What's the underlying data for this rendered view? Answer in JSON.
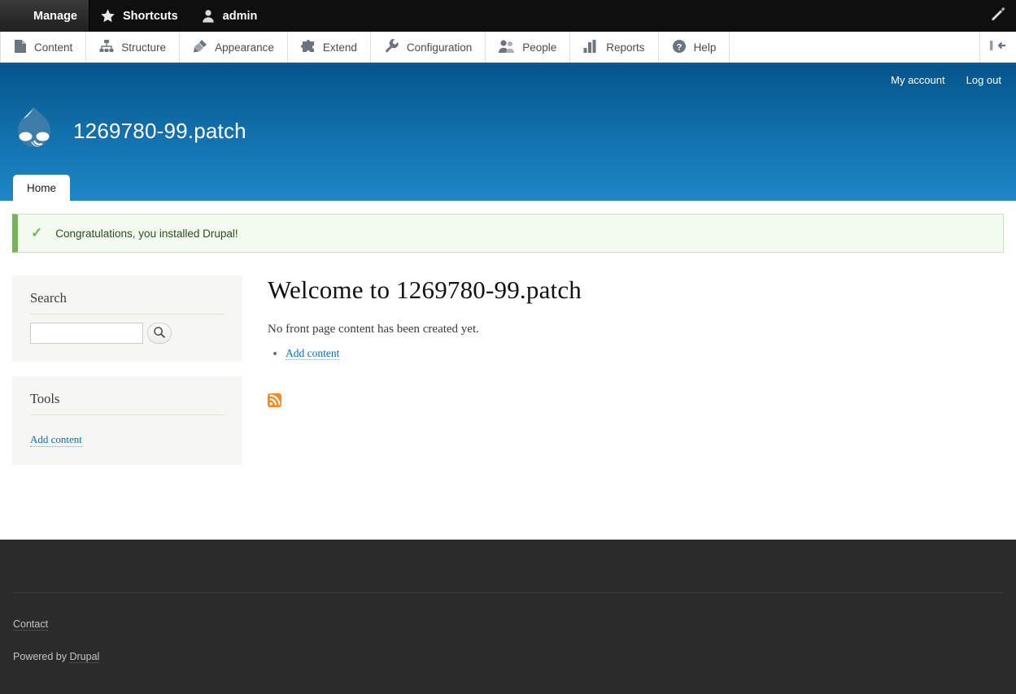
{
  "toolbar": {
    "tabs": [
      {
        "label": "Manage",
        "icon": "hamburger-icon",
        "active": true
      },
      {
        "label": "Shortcuts",
        "icon": "star-icon",
        "active": false
      },
      {
        "label": "admin",
        "icon": "user-icon",
        "active": false
      }
    ],
    "edit_icon": "pencil-icon"
  },
  "admin_menu": {
    "items": [
      {
        "label": "Content",
        "icon": "document-icon"
      },
      {
        "label": "Structure",
        "icon": "sitemap-icon"
      },
      {
        "label": "Appearance",
        "icon": "paintbrush-icon"
      },
      {
        "label": "Extend",
        "icon": "puzzle-piece-icon"
      },
      {
        "label": "Configuration",
        "icon": "wrench-icon"
      },
      {
        "label": "People",
        "icon": "people-icon"
      },
      {
        "label": "Reports",
        "icon": "bar-chart-icon"
      },
      {
        "label": "Help",
        "icon": "question-mark-icon"
      }
    ],
    "orientation_toggle": "vertical-orientation-icon"
  },
  "header": {
    "site_name": "1269780-99.patch",
    "logo": "drupal-droplet-logo",
    "user_links": [
      {
        "label": "My account"
      },
      {
        "label": "Log out"
      }
    ],
    "tabs": [
      {
        "label": "Home",
        "active": true
      }
    ]
  },
  "message": {
    "icon": "checkmark-icon",
    "text": "Congratulations, you installed Drupal!"
  },
  "sidebar": {
    "blocks": [
      {
        "title": "Search",
        "search_value": "",
        "search_placeholder": "",
        "search_button_icon": "magnifier-icon"
      },
      {
        "title": "Tools",
        "links": [
          {
            "label": "Add content"
          }
        ]
      }
    ]
  },
  "main": {
    "title": "Welcome to 1269780-99.patch",
    "body": "No front page content has been created yet.",
    "links": [
      {
        "label": "Add content"
      }
    ],
    "feed_icon": "rss-feed-icon"
  },
  "footer": {
    "links": [
      {
        "label": "Contact"
      }
    ],
    "powered_prefix": "Powered by ",
    "powered_link": "Drupal"
  },
  "colors": {
    "toolbar_bg": "#0f0f0f",
    "header_blue_top": "#05538c",
    "header_blue_bottom": "#1f86c6",
    "accent_link": "#0071b3",
    "status_green": "#77b259",
    "footer_bg": "#2b2b2b",
    "rss_orange": "#f08a24"
  }
}
